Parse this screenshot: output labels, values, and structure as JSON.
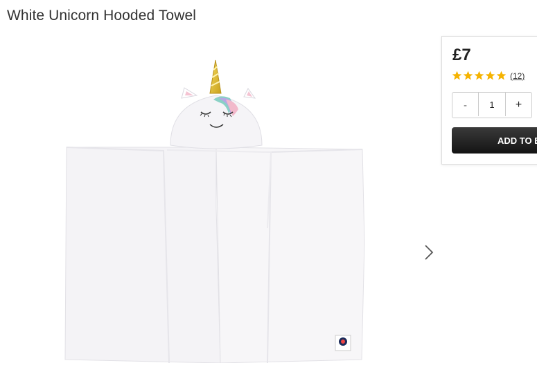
{
  "product": {
    "title": "White Unicorn Hooded Towel",
    "price": "£7",
    "rating": 5,
    "review_count": "(12)",
    "quantity": "1",
    "qty_minus": "-",
    "qty_plus": "+",
    "add_to_bag": "ADD TO BAG"
  },
  "gallery": {
    "next_icon": "chevron-right-icon"
  },
  "colors": {
    "star": "#f5b301",
    "button": "#1e1e1e"
  }
}
